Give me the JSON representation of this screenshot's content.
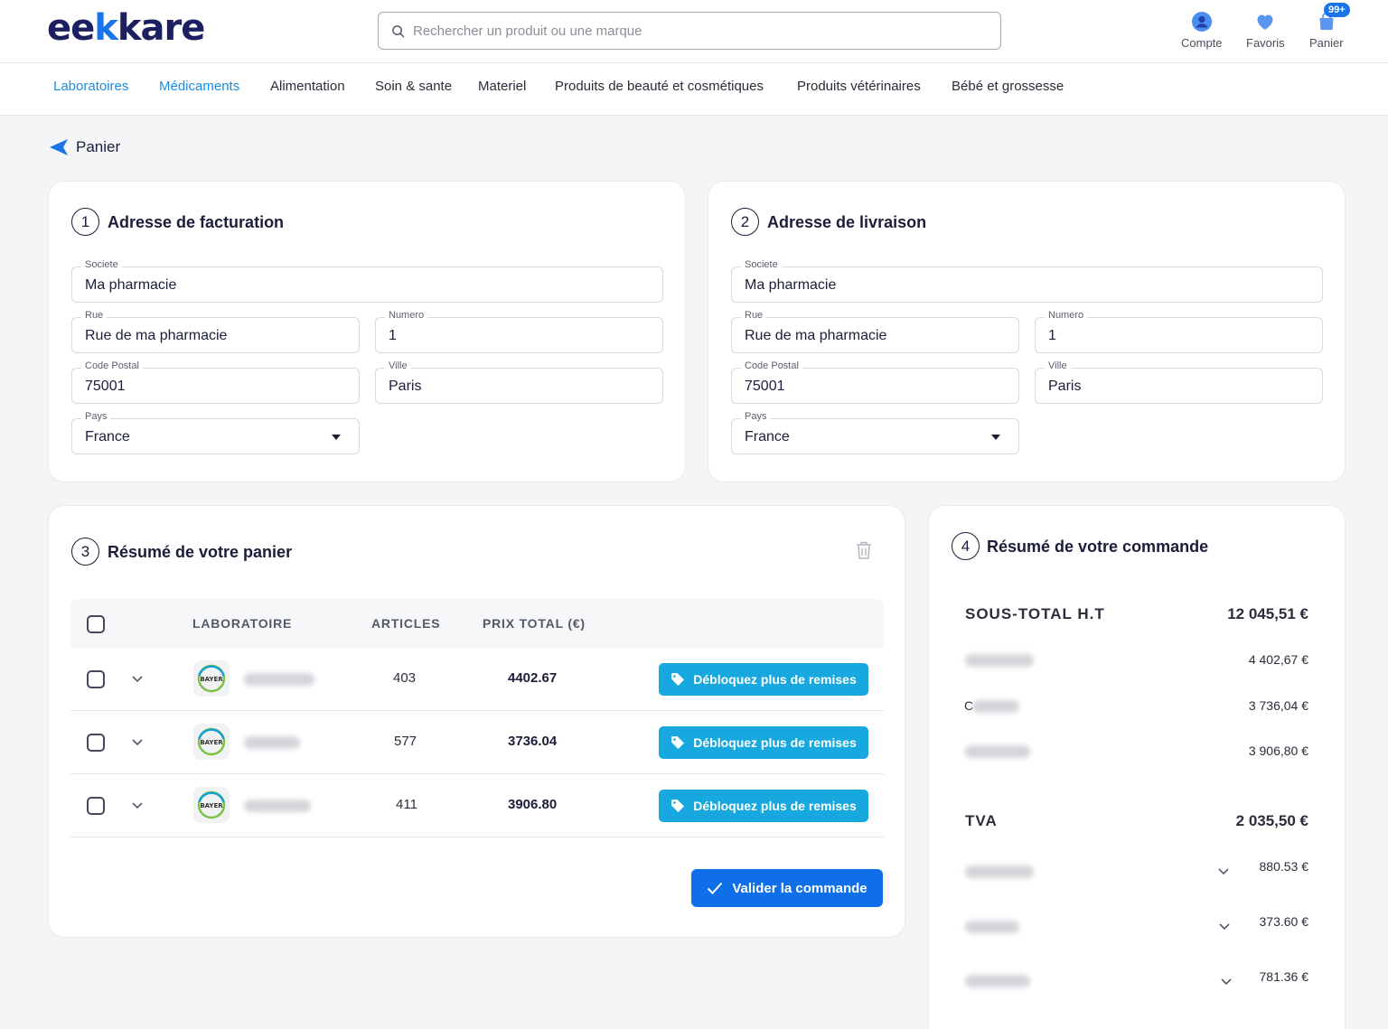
{
  "header": {
    "logo_pre": "ee",
    "logo_k": "k",
    "logo_post": "kare",
    "search_placeholder": "Rechercher un produit ou une marque",
    "account_label": "Compte",
    "favorites_label": "Favoris",
    "cart_label": "Panier",
    "cart_badge": "99+"
  },
  "nav": {
    "items": [
      "Laboratoires",
      "Médicaments",
      "Alimentation",
      "Soin & sante",
      "Materiel",
      "Produits de beauté et cosmétiques",
      "Produits vétérinaires",
      "Bébé et grossesse"
    ]
  },
  "back_label": "Panier",
  "billing": {
    "step": "1",
    "title": "Adresse de facturation",
    "fields": {
      "societe_label": "Societe",
      "societe": "Ma pharmacie",
      "rue_label": "Rue",
      "rue": "Rue de ma pharmacie",
      "numero_label": "Numero",
      "numero": "1",
      "cp_label": "Code Postal",
      "cp": "75001",
      "ville_label": "Ville",
      "ville": "Paris",
      "pays_label": "Pays",
      "pays": "France"
    }
  },
  "shipping": {
    "step": "2",
    "title": "Adresse de livraison",
    "fields": {
      "societe_label": "Societe",
      "societe": "Ma pharmacie",
      "rue_label": "Rue",
      "rue": "Rue de ma pharmacie",
      "numero_label": "Numero",
      "numero": "1",
      "cp_label": "Code Postal",
      "cp": "75001",
      "ville_label": "Ville",
      "ville": "Paris",
      "pays_label": "Pays",
      "pays": "France"
    }
  },
  "cart": {
    "step": "3",
    "title": "Résumé de votre panier",
    "columns": {
      "lab": "LABORATOIRE",
      "articles": "ARTICLES",
      "total": "PRIX TOTAL (€)"
    },
    "rows": [
      {
        "articles": "403",
        "total": "4402.67",
        "action": "Débloquez plus de remises"
      },
      {
        "articles": "577",
        "total": "3736.04",
        "action": "Débloquez plus de remises"
      },
      {
        "articles": "411",
        "total": "3906.80",
        "action": "Débloquez plus de remises"
      }
    ],
    "validate_label": "Valider la commande"
  },
  "order": {
    "step": "4",
    "title": "Résumé de votre commande",
    "subtotal_label": "SOUS-TOTAL H.T",
    "subtotal_value": "12 045,51 €",
    "subtotal_lines": [
      "4 402,67 €",
      "3 736,04 €",
      "3 906,80 €"
    ],
    "partial_char": "C",
    "tva_label": "TVA",
    "tva_value": "2 035,50 €",
    "tva_lines": [
      "880.53 €",
      "373.60 €",
      "781.36 €"
    ]
  },
  "colors": {
    "brand": "#1d2060",
    "accent": "#1a73e8",
    "remise": "#17a8e0",
    "validate": "#0f6fe8"
  }
}
